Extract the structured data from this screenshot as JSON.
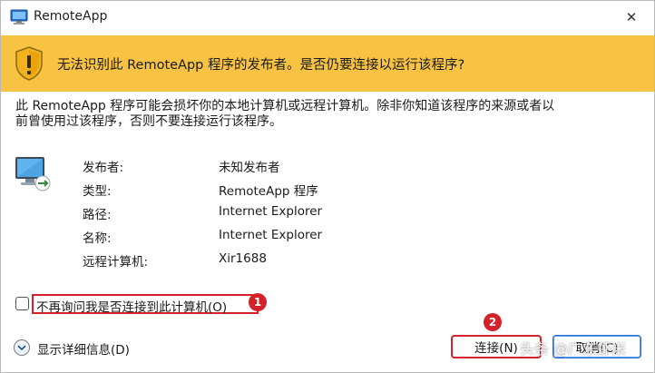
{
  "window": {
    "title": "RemoteApp",
    "close_glyph": "✕"
  },
  "banner": {
    "message": "无法识别此 RemoteApp 程序的发布者。是否仍要连接以运行该程序?",
    "icon": "warning-shield-icon",
    "color": "#f8c342"
  },
  "description": {
    "line1": "此 RemoteApp 程序可能会损坏你的本地计算机或远程计算机。除非你知道该程序的来源或者以",
    "line2": "前曾使用过该程序，否则不要连接运行该程序。"
  },
  "info": {
    "icon": "remote-computer-icon",
    "rows": [
      {
        "label": "发布者:",
        "value": "未知发布者"
      },
      {
        "label": "类型:",
        "value": "RemoteApp 程序"
      },
      {
        "label": "路径:",
        "value": "Internet Explorer"
      },
      {
        "label": "名称:",
        "value": "Internet Explorer"
      },
      {
        "label": "远程计算机:",
        "value": "Xir1688"
      }
    ]
  },
  "dont_ask": {
    "label": "不再询问我是否连接到此计算机(O)",
    "checked": false,
    "badge": "1"
  },
  "details_toggle": {
    "label": "显示详细信息(D)",
    "icon": "chevron-down-icon"
  },
  "buttons": {
    "connect": "连接(N)",
    "connect_badge": "2",
    "cancel": "取消(C)"
  },
  "watermark": "头条 @广东虾米",
  "annotation_color": "#d4222a"
}
